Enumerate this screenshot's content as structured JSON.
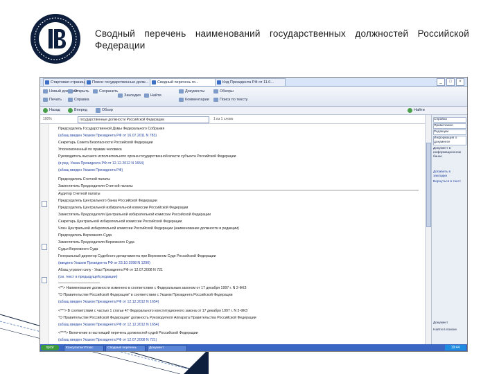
{
  "slide": {
    "title": "Сводный перечень наименований государственных должностей Российской Федерации",
    "accent_color": "#0d1f3c"
  },
  "browser": {
    "tabs": [
      {
        "label": "Стартовая страница"
      },
      {
        "label": "Поиск: государственные долж..."
      },
      {
        "label": "Сводный перечень го..."
      },
      {
        "label": "Код Президента РФ от 11.0..."
      }
    ],
    "ribbon": [
      {
        "label": "Новый документ"
      },
      {
        "label": "Открыть"
      },
      {
        "label": "Сохранить"
      },
      {
        "label": "Печать"
      },
      {
        "label": "Справка"
      },
      {
        "label": "Закладки"
      },
      {
        "label": "Найти"
      },
      {
        "label": "Документы"
      },
      {
        "label": "Комментарии"
      },
      {
        "label": "Обзоры"
      },
      {
        "label": "Поиск по тексту"
      }
    ],
    "nav": [
      {
        "label": "Назад"
      },
      {
        "label": "Вперед"
      },
      {
        "label": "Обзор"
      },
      {
        "label": "Найти"
      }
    ],
    "search_value": "государственные должности Российской Федерации",
    "search_hint": "1 из 1 слово",
    "zoom": "100%"
  },
  "document": {
    "lines": [
      "Председатель Государственной Думы Федерального Собрания",
      "(абзац введен Указом Президента РФ от 16.07.2011 N 783)",
      "Секретарь Совета Безопасности Российской Федерации",
      "Уполномоченный по правам человека",
      "Руководитель высшего исполнительного органа государственной власти субъекта Российской Федерации",
      "(в ред. Указа Президента РФ от 12.12.2012 N 1654)",
      "(абзац введен Указом Президента РФ)",
      "Председатель Счетной палаты",
      "Заместитель Председателя Счетной палаты",
      "Аудитор Счетной палаты",
      "Председатель Центрального банка Российской Федерации",
      "Председатель Центральной избирательной комиссии Российской Федерации",
      "Заместитель Председателя Центральной избирательной комиссии Российской Федерации",
      "Секретарь Центральной избирательной комиссии Российской Федерации",
      "Член Центральной избирательной комиссии Российской Федерации (наименование должности в редакции)",
      "Председатель Верховного Суда",
      "Заместитель Председателя Верховного Суда",
      "Судья Верховного Суда",
      "Генеральный директор Судебного департамента при Верховном Суде Российской Федерации",
      "(введено Указом Президента РФ от 23.10.1998 N 1290)",
      "Абзац утратил силу - Указ Президента РФ от 12.07.2008 N 721",
      "(см. текст в предыдущей редакции)",
      "<**> Наименование должности изменено в соответствии с Федеральным законом от 17 декабря 1997 г. N 2-ФКЗ",
      "\"О Правительстве Российской Федерации\" в соответствии с Указом Президента Российской Федерации",
      "(абзац введен Указом Президента РФ от 12.12.2012 N 1654)",
      "<***> В соответствии с частью 1 статьи 47 Федерального конституционного закона от 17 декабря 1997 г. N 2-ФКЗ",
      "\"О Правительстве Российской Федерации\" должность Руководителя Аппарата Правительства Российской Федерации",
      "(абзац введен Указом Президента РФ от 12.12.2012 N 1654)",
      "<****> Включение в настоящий перечень должностей судей Российской Федерации",
      "(абзац введен Указом Президента РФ от 12.07.2008 N 721)"
    ]
  },
  "right_panel": {
    "items": [
      {
        "label": "Справка"
      },
      {
        "label": "Примечание"
      },
      {
        "label": "Редакции"
      },
      {
        "label": "Информация о документе"
      },
      {
        "label": "Документ в информационном банке"
      },
      {
        "label": "Добавить в закладки"
      },
      {
        "label": "Вернуться в текст"
      },
      {
        "label": "Документ"
      },
      {
        "label": "Найти в поиске"
      }
    ]
  },
  "taskbar": {
    "start": "пуск",
    "buttons": [
      {
        "label": "КонсультантПлюс"
      },
      {
        "label": "Сводный перечень"
      },
      {
        "label": "Документ"
      }
    ],
    "clock": "19:44"
  }
}
